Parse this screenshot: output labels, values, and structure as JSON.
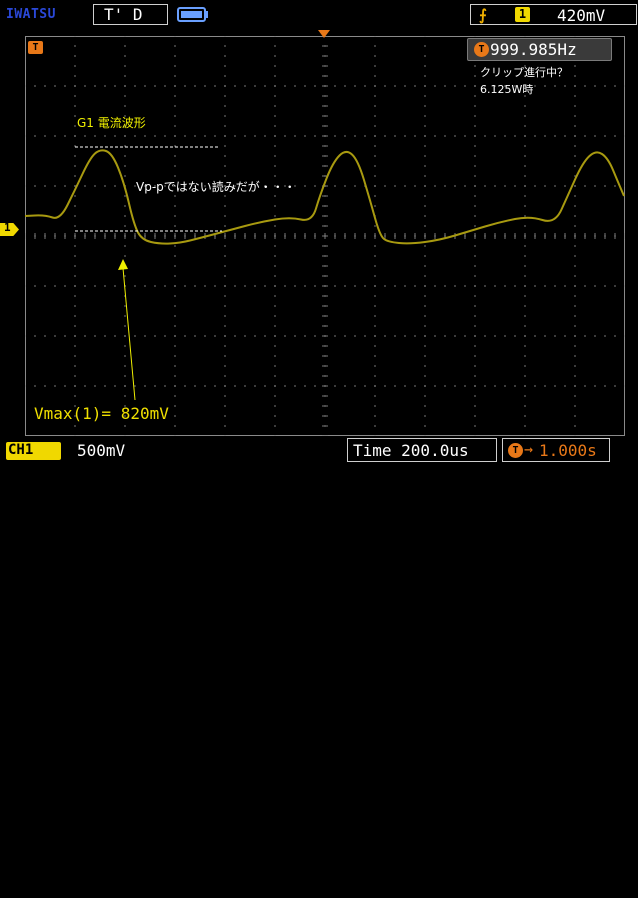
{
  "top_bar": {
    "brand": "IWATSU",
    "mode": "T' D",
    "trigger_edge_icon": "rising-edge-icon",
    "trigger_channel": "1",
    "trigger_level": "420mV"
  },
  "screen": {
    "trigger_marker": "T",
    "channel_marker": "1",
    "frequency": "999.985Hz",
    "frequency_icon": "T",
    "notes": {
      "clip": "クリップ進行中？",
      "power": "6.125W時",
      "title": "G1 電流波形",
      "vpp": "Vp-pではない読みだが・・・"
    },
    "measurement": "Vmax(1)= 820mV",
    "trace_color": "#a89a10"
  },
  "bottom_bar": {
    "channel": "CH1",
    "volts_div": "500mV",
    "time_div": "Time 200.0us",
    "delay_icon": "T",
    "delay_arrow": "→",
    "delay": "1.000s"
  }
}
